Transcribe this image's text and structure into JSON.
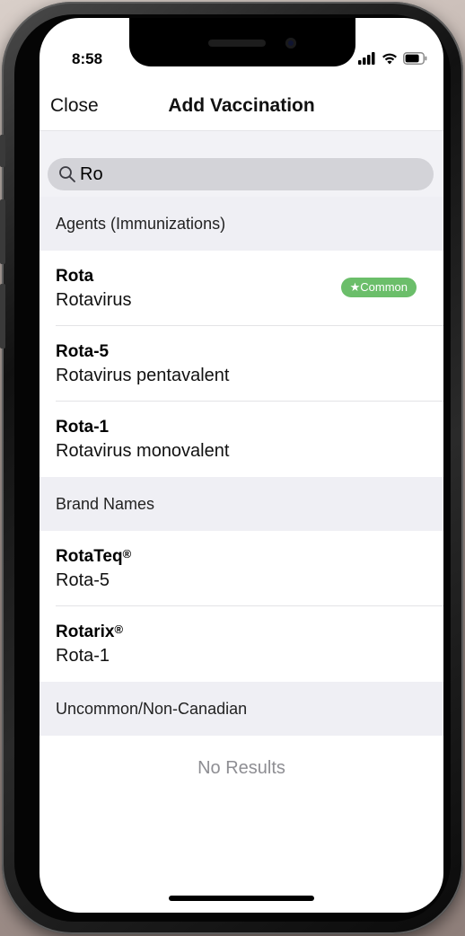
{
  "status_bar": {
    "time": "8:58",
    "icons": [
      "cellular-signal-icon",
      "wifi-icon",
      "battery-icon"
    ]
  },
  "nav": {
    "close_label": "Close",
    "title": "Add Vaccination"
  },
  "search": {
    "value": "Ro",
    "icon": "search-icon"
  },
  "sections": {
    "agents": {
      "header": "Agents (Immunizations)",
      "rows": [
        {
          "title": "Rota",
          "subtitle": "Rotavirus",
          "badge": "★Common"
        },
        {
          "title": "Rota-5",
          "subtitle": "Rotavirus pentavalent"
        },
        {
          "title": "Rota-1",
          "subtitle": "Rotavirus monovalent"
        }
      ]
    },
    "brands": {
      "header": "Brand Names",
      "rows": [
        {
          "title": "RotaTeq",
          "mark": "®",
          "subtitle": "Rota-5"
        },
        {
          "title": "Rotarix",
          "mark": "®",
          "subtitle": "Rota-1"
        }
      ]
    },
    "uncommon": {
      "header": "Uncommon/Non-Canadian",
      "empty_text": "No Results"
    }
  },
  "colors": {
    "badge": "#6bbe6a",
    "section_bg": "#efeff4",
    "search_bg": "#d3d3d8"
  }
}
